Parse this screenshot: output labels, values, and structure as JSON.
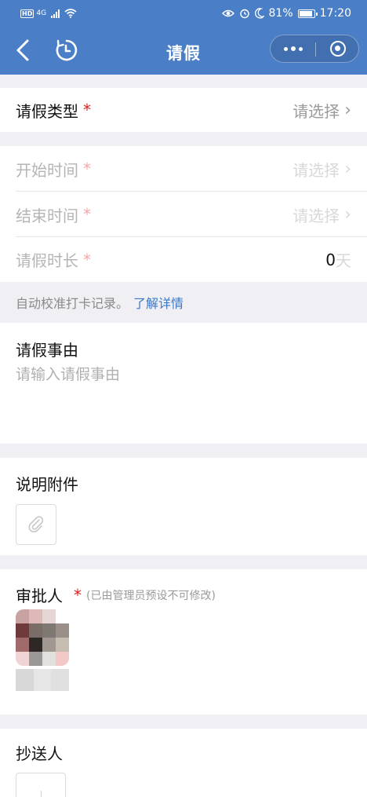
{
  "status_bar": {
    "network": "4G",
    "battery": "81%",
    "time": "17:20"
  },
  "nav": {
    "title": "请假"
  },
  "form": {
    "leave_type": {
      "label": "请假类型",
      "required_mark": "*",
      "value": "请选择"
    },
    "start_time": {
      "label": "开始时间",
      "required_mark": "*",
      "value": "请选择"
    },
    "end_time": {
      "label": "结束时间",
      "required_mark": "*",
      "value": "请选择"
    },
    "duration": {
      "label": "请假时长",
      "required_mark": "*",
      "value": "0",
      "unit": "天"
    },
    "hint": {
      "text": "自动校准打卡记录。",
      "link": "了解详情"
    },
    "reason": {
      "label": "请假事由",
      "placeholder": "请输入请假事由"
    },
    "attachment": {
      "label": "说明附件"
    },
    "approver": {
      "label": "审批人",
      "required_mark": "*",
      "note": "(已由管理员预设不可修改)"
    },
    "cc": {
      "label": "抄送人"
    }
  },
  "icons": {
    "back": "back-arrow-icon",
    "history": "history-clock-icon",
    "more": "more-dots-icon",
    "close": "close-miniprogram-icon",
    "chevron": "chevron-right-icon",
    "attachment": "paperclip-icon"
  },
  "colors": {
    "header": "#4a7fc8",
    "link": "#3b78c6",
    "required": "#e02020",
    "background": "#efeff4"
  }
}
